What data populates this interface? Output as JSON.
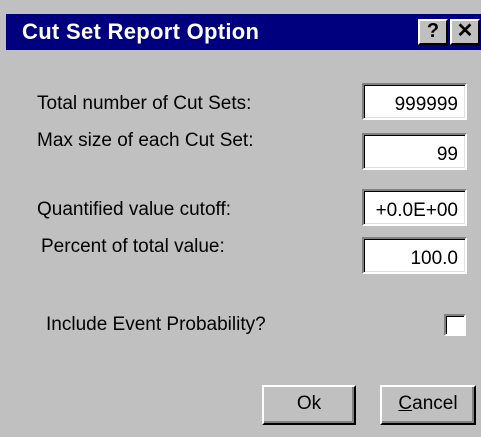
{
  "window": {
    "title": "Cut Set Report Option",
    "help_label": "?",
    "close_label": "✕"
  },
  "fields": {
    "total_cut_sets": {
      "label": "Total number of Cut Sets:",
      "value": "999999"
    },
    "max_size": {
      "label": "Max size of each Cut Set:",
      "value": "99"
    },
    "quantified_cutoff": {
      "label": "Quantified value cutoff:",
      "value": "+0.0E+00"
    },
    "percent_total": {
      "label": "Percent of total value:",
      "value": "100.0"
    }
  },
  "include_event_probability": {
    "label": "Include Event Probability?",
    "checked": false
  },
  "buttons": {
    "ok_label": "Ok",
    "cancel_label": "Cancel",
    "cancel_mnemonic": "C",
    "cancel_rest": "ancel"
  },
  "colors": {
    "titlebar": "#00007f",
    "face": "#c0c0c0"
  }
}
